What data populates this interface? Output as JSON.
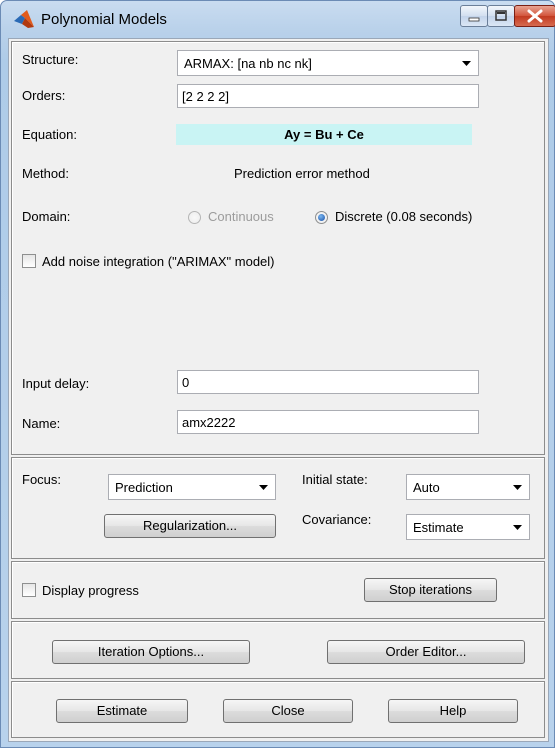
{
  "window": {
    "title": "Polynomial Models"
  },
  "structure": {
    "label": "Structure:",
    "selected": "ARMAX: [na nb nc nk]"
  },
  "orders": {
    "label": "Orders:",
    "value": "[2 2 2 2]"
  },
  "equation": {
    "label": "Equation:",
    "value": "Ay = Bu + Ce"
  },
  "method": {
    "label": "Method:",
    "value": "Prediction error method"
  },
  "domain": {
    "label": "Domain:",
    "continuous_label": "Continuous",
    "discrete_label": "Discrete (0.08 seconds)",
    "selected": "Discrete"
  },
  "noise": {
    "label": "Add noise integration (\"ARIMAX\" model)",
    "checked": false
  },
  "input_delay": {
    "label": "Input delay:",
    "value": "0"
  },
  "name": {
    "label": "Name:",
    "value": "amx2222"
  },
  "focus": {
    "label": "Focus:",
    "selected": "Prediction"
  },
  "initial_state": {
    "label": "Initial state:",
    "selected": "Auto"
  },
  "covariance": {
    "label": "Covariance:",
    "selected": "Estimate"
  },
  "regularization_button": "Regularization...",
  "display_progress": {
    "label": "Display progress",
    "checked": false
  },
  "stop_iterations_button": "Stop iterations",
  "iteration_options_button": "Iteration Options...",
  "order_editor_button": "Order Editor...",
  "footer": {
    "estimate": "Estimate",
    "close": "Close",
    "help": "Help"
  },
  "colors": {
    "equation_bg": "#c9f4f4",
    "title_close": "#c23a20"
  }
}
